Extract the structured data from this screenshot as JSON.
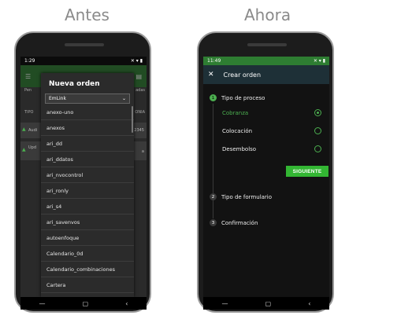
{
  "captions": {
    "before": "Antes",
    "after": "Ahora"
  },
  "left": {
    "status_time": "1:29",
    "tabs": [
      "Pen",
      "adas"
    ],
    "table_head": [
      "TIPO",
      "ONIA"
    ],
    "rows": [
      {
        "text": "Audi",
        "num": "2345"
      },
      {
        "text": "Upd",
        "num": "a"
      }
    ],
    "dialog": {
      "title": "Nueva orden",
      "selected": "EmLink",
      "items": [
        "anexo-uno",
        "anexos",
        "ari_dd",
        "ari_ddatos",
        "ari_nvocontrol",
        "ari_ronly",
        "ari_s4",
        "ari_savenvos",
        "autoenfoque",
        "Calendario_0d",
        "Calendario_combinaciones",
        "Cartera"
      ]
    }
  },
  "right": {
    "status_time": "11:49",
    "toolbar_title": "Crear orden",
    "steps": [
      {
        "number": "1",
        "label": "Tipo de proceso"
      },
      {
        "number": "2",
        "label": "Tipo de formulario"
      },
      {
        "number": "3",
        "label": "Confirmación"
      }
    ],
    "options": [
      {
        "label": "Cobranza",
        "selected": true
      },
      {
        "label": "Colocación",
        "selected": false
      },
      {
        "label": "Desembolso",
        "selected": false
      }
    ],
    "next_label": "SIGUIENTE"
  },
  "colors": {
    "accent": "#4caf50",
    "button": "#33b633",
    "toolbar": "#1e3037"
  }
}
